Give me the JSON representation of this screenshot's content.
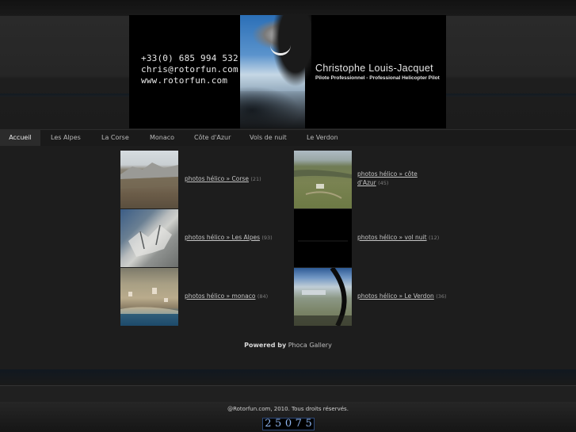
{
  "banner": {
    "phone": "+33(0) 685 994 532",
    "email": "chris@rotorfun.com",
    "website": "www.rotorfun.com",
    "name": "Christophe Louis-Jacquet",
    "subtitle": "Pilote Professionnel - Professional Helicopter Pilot"
  },
  "nav": {
    "items": [
      {
        "label": "Accueil"
      },
      {
        "label": "Les Alpes"
      },
      {
        "label": "La Corse"
      },
      {
        "label": "Monaco"
      },
      {
        "label": "Côte d'Azur"
      },
      {
        "label": "Vols de nuit"
      },
      {
        "label": "Le Verdon"
      }
    ],
    "active": "Accueil"
  },
  "gallery": {
    "categories": [
      {
        "link": "photos hélico » Corse",
        "count": "(21)"
      },
      {
        "link": "photos hélico » côte d'Azur",
        "count": "(45)"
      },
      {
        "link": "photos hélico » Les Alpes",
        "count": "(93)"
      },
      {
        "link": "photos hélico » vol nuit",
        "count": "(12)"
      },
      {
        "link": "photos hélico » monaco",
        "count": "(84)"
      },
      {
        "link": "photos hélico » Le Verdon",
        "count": "(36)"
      }
    ]
  },
  "powered": {
    "prefix": "Powered by",
    "link": "Phoca Gallery"
  },
  "footer": {
    "copyright": "@Rotorfun.com, 2010. Tous droits réservés.",
    "counter_digits": [
      "2",
      "5",
      "0",
      "7",
      "5"
    ]
  }
}
